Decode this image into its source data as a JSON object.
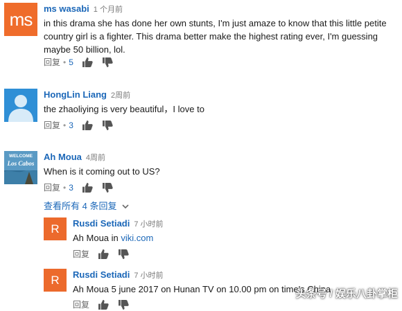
{
  "comments": [
    {
      "author": "ms wasabi",
      "avatar_text": "ms",
      "time": "1 个月前",
      "text": "in this drama she has done her own stunts, I'm just amaze to know that this little petite country girl is a fighter.  This drama better make the highest rating ever, I'm guessing maybe 50 billion, lol.",
      "reply_label": "回复",
      "likes": "5"
    },
    {
      "author": "HongLin Liang",
      "time": "2周前",
      "text": "the zhaoliying is very beautiful，I love to",
      "reply_label": "回复",
      "likes": "3"
    },
    {
      "author": "Ah Moua",
      "avatar_text": "WELCOME Los Cabos",
      "time": "4周前",
      "text": "When is it coming out to US?",
      "reply_label": "回复",
      "likes": "3",
      "view_replies": "查看所有 4 条回复"
    }
  ],
  "replies": [
    {
      "author": "Rusdi Setiadi",
      "avatar_text": "R",
      "time": "7 小时前",
      "text_prefix": "Ah Moua in ",
      "link": "viki.com",
      "reply_label": "回复"
    },
    {
      "author": "Rusdi Setiadi",
      "avatar_text": "R",
      "time": "7 小时前",
      "text": "Ah Moua 5 june 2017 on Hunan TV on 10.00 pm on time's China",
      "reply_label": "回复"
    }
  ],
  "watermark": "头条号 / 娱乐八卦掌柜",
  "colors": {
    "author": "#1b67b8",
    "avatar_ms": "#ef6c2b",
    "avatar_hl": "#2f8fd6",
    "avatar_r": "#ec6a2c"
  },
  "icons": {
    "like": "thumbs-up-icon",
    "dislike": "thumbs-down-icon",
    "expand": "chevron-down-icon"
  }
}
